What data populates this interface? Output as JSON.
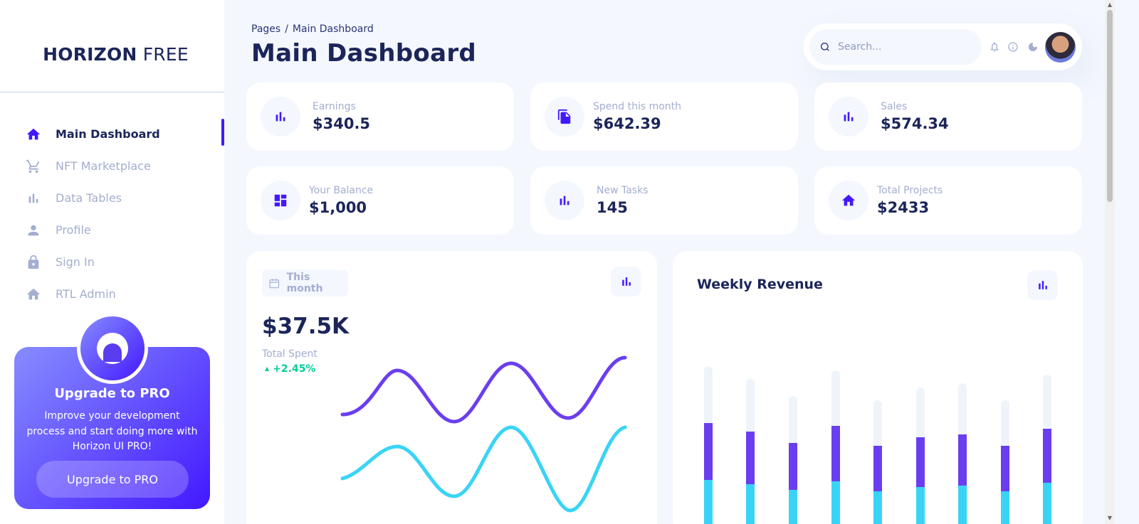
{
  "brand": {
    "bold": "HORIZON",
    "light": "FREE"
  },
  "sidebar": {
    "items": [
      {
        "label": "Main Dashboard",
        "icon": "home-icon",
        "active": true
      },
      {
        "label": "NFT Marketplace",
        "icon": "cart-icon",
        "active": false
      },
      {
        "label": "Data Tables",
        "icon": "bar-chart-icon",
        "active": false
      },
      {
        "label": "Profile",
        "icon": "person-icon",
        "active": false
      },
      {
        "label": "Sign In",
        "icon": "lock-icon",
        "active": false
      },
      {
        "label": "RTL Admin",
        "icon": "home-icon",
        "active": false
      }
    ],
    "promo": {
      "title": "Upgrade to PRO",
      "text": "Improve your development process and start doing more with Horizon UI PRO!",
      "button": "Upgrade to PRO"
    }
  },
  "header": {
    "breadcrumb": {
      "root": "Pages",
      "separator": "/",
      "current": "Main Dashboard"
    },
    "title": "Main Dashboard",
    "search": {
      "placeholder": "Search...",
      "value": ""
    }
  },
  "stats": [
    {
      "label": "Earnings",
      "value": "$340.5",
      "icon": "bar-chart-icon"
    },
    {
      "label": "Spend this month",
      "value": "$642.39",
      "icon": "documents-icon"
    },
    {
      "label": "Sales",
      "value": "$574.34",
      "icon": "bar-chart-icon"
    },
    {
      "label": "Your Balance",
      "value": "$1,000",
      "icon": "dashboard-icon"
    },
    {
      "label": "New Tasks",
      "value": "145",
      "icon": "bar-chart-icon"
    },
    {
      "label": "Total Projects",
      "value": "$2433",
      "icon": "home-icon"
    }
  ],
  "total_spent": {
    "period_button": "This month",
    "value": "$37.5K",
    "label": "Total Spent",
    "change": "+2.45%"
  },
  "weekly_revenue": {
    "title": "Weekly Revenue"
  },
  "colors": {
    "brand": "#4318ff",
    "purple_series": "#6a3ef0",
    "cyan_series": "#39d4f5",
    "background": "#f4f7fe",
    "positive": "#05cd99"
  }
}
